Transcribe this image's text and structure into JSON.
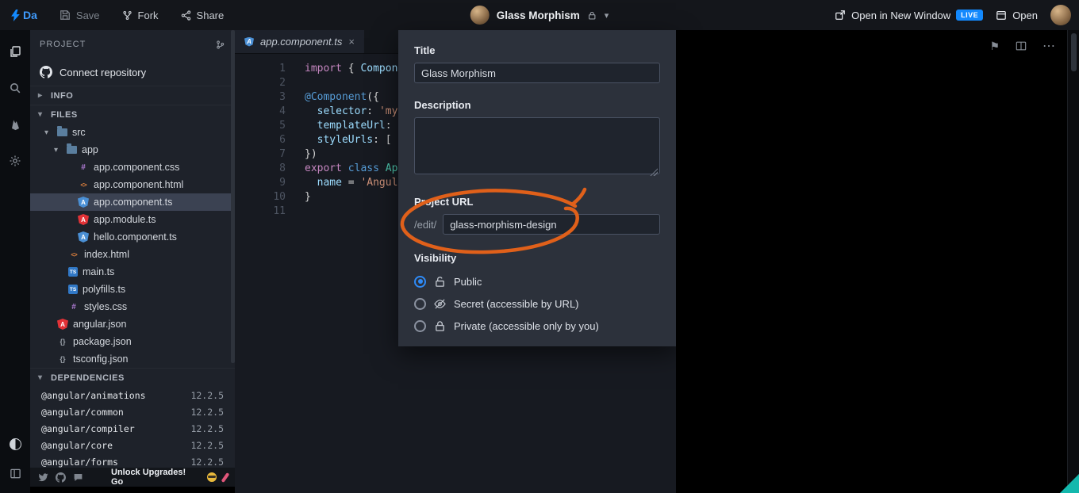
{
  "topbar": {
    "logo_text": "Da",
    "save_label": "Save",
    "fork_label": "Fork",
    "share_label": "Share",
    "project_title": "Glass Morphism",
    "open_in_new_window_label": "Open in New Window",
    "live_badge": "LIVE",
    "open_label": "Open"
  },
  "sidebar": {
    "project_label": "PROJECT",
    "connect_repository_label": "Connect repository",
    "info_label": "INFO",
    "files_label": "FILES",
    "dependencies_label": "DEPENDENCIES",
    "tree": [
      {
        "name": "src",
        "type": "folder"
      },
      {
        "name": "app",
        "type": "folder"
      },
      {
        "name": "app.component.css",
        "type": "css"
      },
      {
        "name": "app.component.html",
        "type": "html"
      },
      {
        "name": "app.component.ts",
        "type": "angular-component",
        "selected": true
      },
      {
        "name": "app.module.ts",
        "type": "angular"
      },
      {
        "name": "hello.component.ts",
        "type": "angular-component"
      },
      {
        "name": "index.html",
        "type": "html"
      },
      {
        "name": "main.ts",
        "type": "ts"
      },
      {
        "name": "polyfills.ts",
        "type": "ts"
      },
      {
        "name": "styles.css",
        "type": "css"
      },
      {
        "name": "angular.json",
        "type": "angular"
      },
      {
        "name": "package.json",
        "type": "json"
      },
      {
        "name": "tsconfig.json",
        "type": "json"
      }
    ],
    "dependencies": [
      {
        "name": "@angular/animations",
        "version": "12.2.5"
      },
      {
        "name": "@angular/common",
        "version": "12.2.5"
      },
      {
        "name": "@angular/compiler",
        "version": "12.2.5"
      },
      {
        "name": "@angular/core",
        "version": "12.2.5"
      },
      {
        "name": "@angular/forms",
        "version": "12.2.5"
      }
    ],
    "footer_text": "Unlock Upgrades! Go"
  },
  "editor": {
    "tab_label": "app.component.ts",
    "lines": [
      {
        "n": "1",
        "tokens": [
          "import ",
          "{ ",
          "Compone"
        ]
      },
      {
        "n": "2",
        "tokens": []
      },
      {
        "n": "3",
        "tokens": [
          "@Component",
          "({"
        ]
      },
      {
        "n": "4",
        "tokens": [
          "  ",
          "selector",
          ": ",
          "'my-"
        ]
      },
      {
        "n": "5",
        "tokens": [
          "  ",
          "templateUrl",
          ": ",
          "'"
        ]
      },
      {
        "n": "6",
        "tokens": [
          "  ",
          "styleUrls",
          ": [ ",
          "'"
        ]
      },
      {
        "n": "7",
        "tokens": [
          "})"
        ]
      },
      {
        "n": "8",
        "tokens": [
          "export ",
          "class ",
          "App"
        ]
      },
      {
        "n": "9",
        "tokens": [
          "  ",
          "name",
          " = ",
          "'Angula"
        ]
      },
      {
        "n": "10",
        "tokens": [
          "}"
        ]
      },
      {
        "n": "11",
        "tokens": []
      }
    ]
  },
  "dialog": {
    "title_label": "Title",
    "title_value": "Glass Morphism",
    "description_label": "Description",
    "description_value": "",
    "project_url_label": "Project URL",
    "url_prefix": "/edit/",
    "url_value": "glass-morphism-design",
    "visibility_label": "Visibility",
    "options": [
      {
        "label": "Public",
        "selected": true
      },
      {
        "label": "Secret (accessible by URL)",
        "selected": false
      },
      {
        "label": "Private (accessible only by you)",
        "selected": false
      }
    ]
  },
  "glyphs": {
    "chevron_down": "▾",
    "chevron_right": "▸",
    "close": "×",
    "ellipsis": "⋯",
    "flag": "⚑"
  },
  "colors": {
    "accent_blue": "#1389fd",
    "annotation_orange": "#e0601a",
    "live_badge": "#1389fd"
  }
}
